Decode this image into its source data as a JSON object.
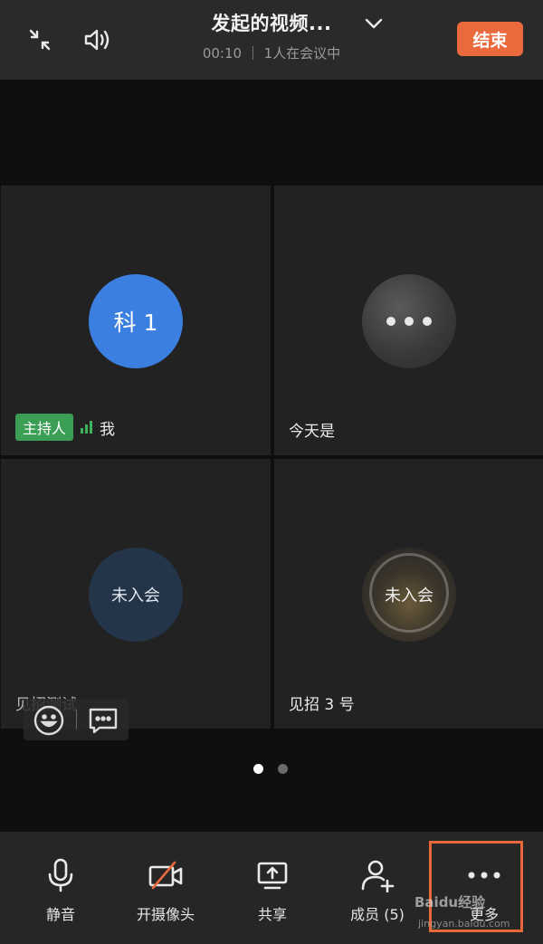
{
  "header": {
    "title": "发起的视频...",
    "subtitle": "00:10 ｜ 1人在会议中",
    "end_label": "结束"
  },
  "tiles": [
    {
      "avatar_text": "科 1",
      "host_badge": "主持人",
      "name": "我",
      "avatar_style": "blue"
    },
    {
      "avatar_text": "",
      "name": "今天是",
      "avatar_style": "photo"
    },
    {
      "avatar_text": "未入会",
      "name": "见招测试",
      "avatar_style": "dark-blue"
    },
    {
      "avatar_text": "未入会",
      "name": "见招 3 号",
      "avatar_style": "photo-wheel"
    }
  ],
  "pager": {
    "current": 1,
    "total": 2
  },
  "toolbar": {
    "mute_label": "静音",
    "camera_label": "开摄像头",
    "share_label": "共享",
    "members_label": "成员 (5)",
    "more_label": "更多"
  },
  "watermark": {
    "brand": "Baidu经验",
    "url": "jingyan.baidu.com"
  },
  "colors": {
    "accent": "#ea6a3d",
    "host_badge": "#3b9e55",
    "avatar_blue": "#3b7fe0"
  }
}
